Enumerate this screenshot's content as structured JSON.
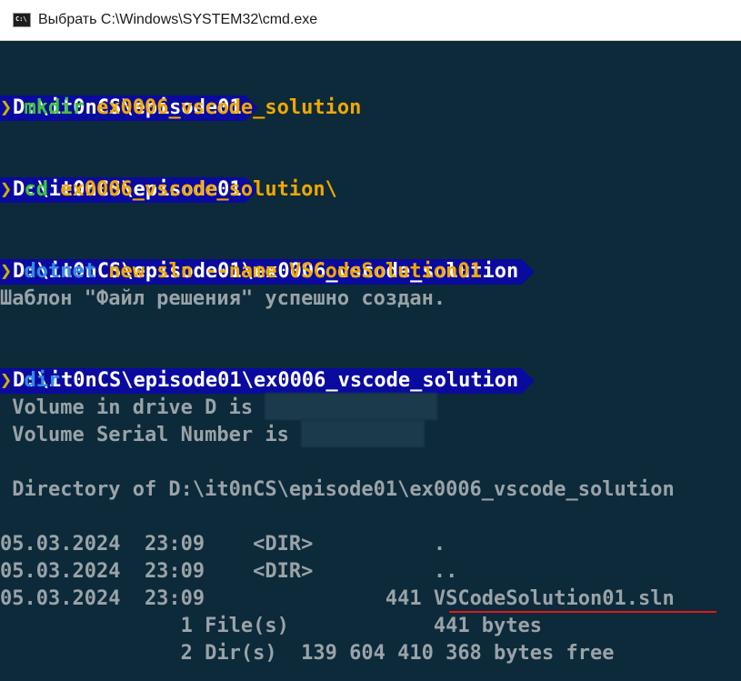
{
  "window": {
    "title": "Выбрать C:\\Windows\\SYSTEM32\\cmd.exe",
    "icon_label": "C:\\",
    "icon": "console-icon"
  },
  "colors": {
    "background": "#0c2a3a",
    "prompt_bg": "#0a0a9e",
    "chevron": "#c8b400",
    "green": "#3ec63e",
    "blue": "#2f8de4",
    "yellow": "#f0a800",
    "gray": "#9aa3a8",
    "underline": "#e0181a"
  },
  "session": {
    "prompt1": "D:\\it0nCS\\episode01",
    "cmd1": {
      "chevron": "❯",
      "command": "mkdir",
      "args": "ex0006_vscode_solution"
    },
    "prompt2": "D:\\it0nCS\\episode01",
    "cmd2": {
      "chevron": "❯",
      "command": "cd",
      "args": "ex0006_vscode_solution\\"
    },
    "prompt3": "D:\\it0nCS\\episode01\\ex0006_vscode_solution",
    "cmd3": {
      "chevron": "❯",
      "command": "dotnet",
      "args": "new sln --name VSCodeSolution01"
    },
    "out3": "Шаблон \"Файл решения\" успешно создан.",
    "prompt4": "D:\\it0nCS\\episode01\\ex0006_vscode_solution",
    "cmd4": {
      "chevron": "❯",
      "command": "dir"
    },
    "dir_output": {
      "volume_label": " Volume in drive D is ",
      "serial_label": " Volume Serial Number is ",
      "directory_of": " Directory of D:\\it0nCS\\episode01\\ex0006_vscode_solution",
      "rows": [
        "05.03.2024  23:09    <DIR>          .",
        "05.03.2024  23:09    <DIR>          ..",
        "05.03.2024  23:09               441 "
      ],
      "sln_file": "VSCodeSolution01.sln",
      "summary_files": "               1 File(s)            441 bytes",
      "summary_dirs": "               2 Dir(s)  139 604 410 368 bytes free"
    }
  }
}
